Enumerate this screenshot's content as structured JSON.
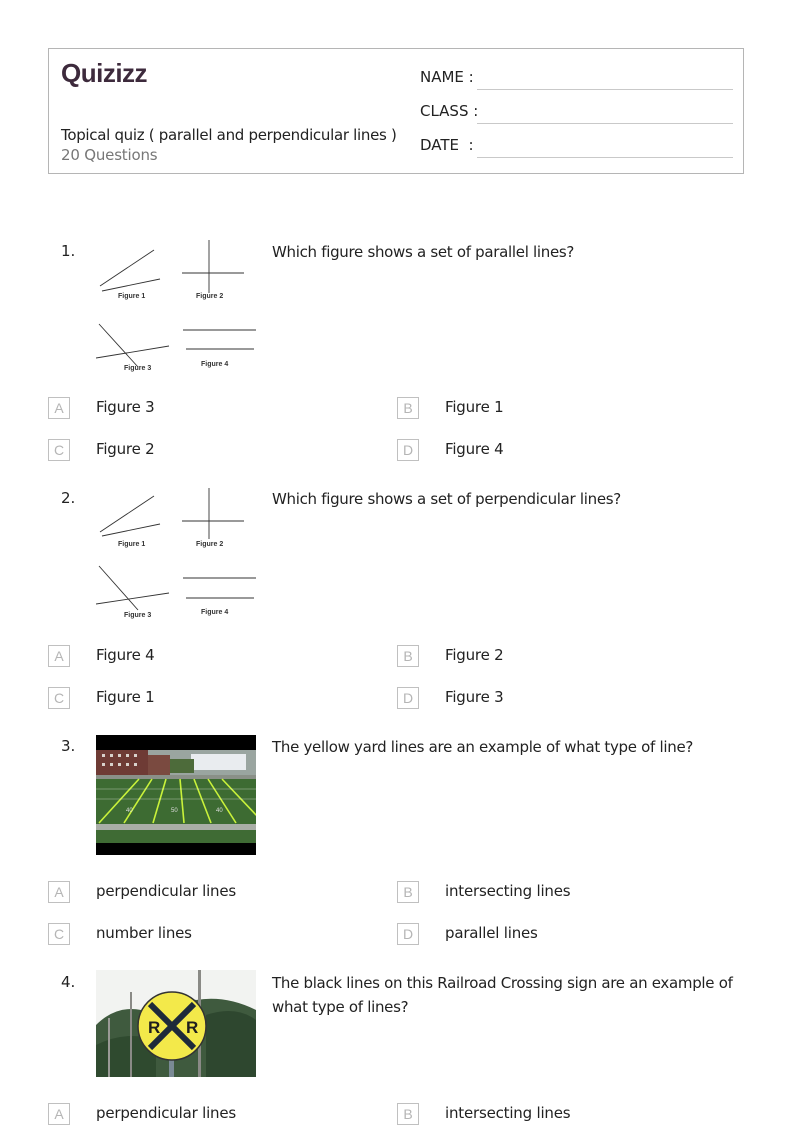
{
  "header": {
    "logo": "Quizizz",
    "title": "Topical quiz ( parallel and perpendicular lines )",
    "question_count": "20 Questions",
    "fields": [
      {
        "label": "NAME :"
      },
      {
        "label": "CLASS :"
      },
      {
        "label": "DATE  :"
      }
    ]
  },
  "figure_labels": [
    "Figure 1",
    "Figure 2",
    "Figure 3",
    "Figure 4"
  ],
  "field_image_yard_labels": [
    "40",
    "50",
    "40"
  ],
  "sign_image_letters": [
    "R",
    "R"
  ],
  "questions": [
    {
      "number": "1.",
      "text": "Which figure shows a set of parallel lines?",
      "image": "figures-diagram",
      "options": [
        {
          "letter": "A",
          "text": "Figure 3"
        },
        {
          "letter": "B",
          "text": "Figure 1"
        },
        {
          "letter": "C",
          "text": "Figure 2"
        },
        {
          "letter": "D",
          "text": "Figure 4"
        }
      ]
    },
    {
      "number": "2.",
      "text": "Which figure shows a set of perpendicular lines?",
      "image": "figures-diagram",
      "options": [
        {
          "letter": "A",
          "text": "Figure 4"
        },
        {
          "letter": "B",
          "text": "Figure 2"
        },
        {
          "letter": "C",
          "text": "Figure 1"
        },
        {
          "letter": "D",
          "text": "Figure 3"
        }
      ]
    },
    {
      "number": "3.",
      "text": "The yellow yard lines are an example of what type of line?",
      "image": "football-field-photo",
      "options": [
        {
          "letter": "A",
          "text": "perpendicular lines"
        },
        {
          "letter": "B",
          "text": "intersecting lines"
        },
        {
          "letter": "C",
          "text": "number lines"
        },
        {
          "letter": "D",
          "text": "parallel lines"
        }
      ]
    },
    {
      "number": "4.",
      "text": "The black lines on this Railroad Crossing sign are an example of what type of lines?",
      "image": "railroad-crossing-sign-photo",
      "options": [
        {
          "letter": "A",
          "text": "perpendicular lines"
        },
        {
          "letter": "B",
          "text": "intersecting lines"
        }
      ]
    }
  ]
}
